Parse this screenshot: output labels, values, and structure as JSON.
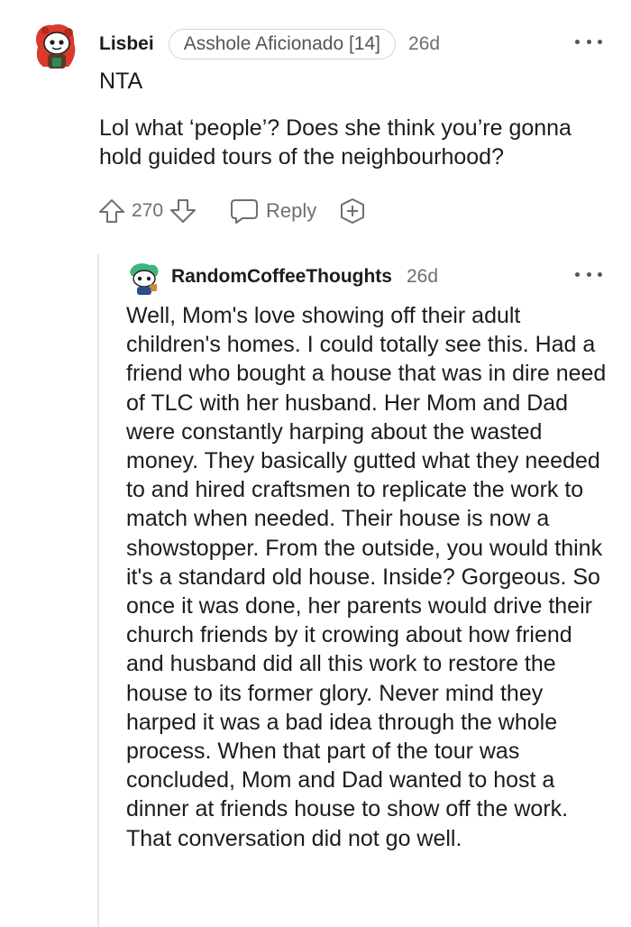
{
  "comment": {
    "author": "Lisbei",
    "flair": "Asshole Aficionado [14]",
    "age": "26d",
    "verdict": "NTA",
    "body": "Lol what ‘people’? Does she think you’re gonna hold guided tours of the neighbourhood?",
    "votes": "270",
    "reply_label": "Reply",
    "avatar_icon": "snoo-avatar-icon",
    "more_icon": "more-options-icon"
  },
  "reply": {
    "author": "RandomCoffeeThoughts",
    "age": "26d",
    "body": "Well, Mom's love showing off their adult children's homes. I could totally see this. Had a friend who bought a house that was in dire need of TLC with her husband. Her Mom and Dad were constantly harping about the wasted money. They basically gutted what they needed to and hired craftsmen to replicate the work to match when needed. Their house is now a showstopper. From the outside, you would think it's a standard old house. Inside? Gorgeous. So once it was done, her parents would drive their church friends by it crowing about how friend and husband did all this work to restore the house to its former glory. Never mind they harped it was a bad idea through the whole process. When that part of the tour was concluded, Mom and Dad wanted to host a dinner at friends house to show off the work. That conversation did not go well.",
    "avatar_icon": "snoo-avatar-icon",
    "more_icon": "more-options-icon"
  },
  "colors": {
    "text": "#1c1c1c",
    "meta": "#6f6f6f",
    "avatar_red": "#d93a2b",
    "avatar_green": "#3fb57a"
  }
}
